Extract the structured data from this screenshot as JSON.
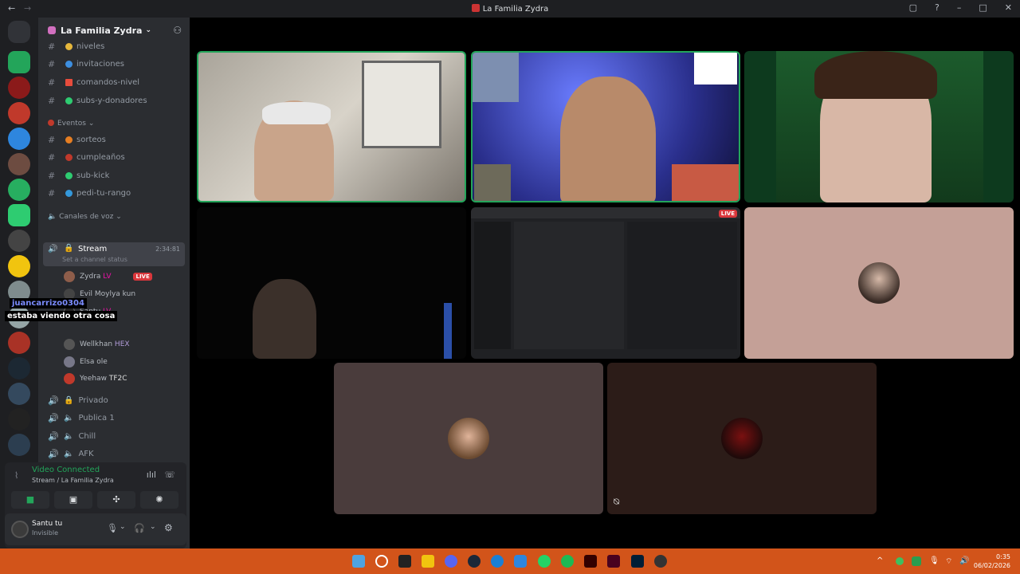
{
  "window": {
    "title": "La Familia Zydra"
  },
  "server": {
    "name": "La Familia Zydra"
  },
  "channels": [
    {
      "name": "niveles",
      "top": 0
    },
    {
      "name": "invitaciones"
    },
    {
      "name": "comandos-nivel"
    },
    {
      "name": "subs-y-donadores"
    }
  ],
  "events_category": "Eventos",
  "event_channels": [
    "sorteos",
    "cumpleaños",
    "sub-kick",
    "pedi-tu-rango"
  ],
  "voice_category": "Canales de voz",
  "stream_channel": {
    "name": "Stream",
    "timer": "2:34:81",
    "status": "Set a channel status"
  },
  "voice_users": [
    {
      "name": "Zydra",
      "tag": "LV",
      "live": "LIVE"
    },
    {
      "name": "Evil Moylya kun"
    },
    {
      "name": "Santu",
      "tag": "LV"
    },
    {
      "name": "Wellkhan",
      "tag": "HEX"
    },
    {
      "name": "Elsa ole"
    },
    {
      "name": "Yeehaw",
      "tag": "TF2C"
    }
  ],
  "other_voice": [
    "Privado",
    "Publica 1",
    "Chill",
    "AFK"
  ],
  "overlay": {
    "name": "juancarrizo0304",
    "message": "estaba viendo otra cosa"
  },
  "connection": {
    "status": "Video Connected",
    "location": "Stream / La Familia Zydra"
  },
  "user": {
    "name": "Santu tu",
    "status": "Invisible"
  },
  "stream_live_label": "LIVE",
  "clock": {
    "time": "0:35",
    "date": "06/02/2026"
  },
  "colors": {
    "accent": "#23a55a",
    "taskbar": "#d2541a",
    "live": "#da373c"
  }
}
